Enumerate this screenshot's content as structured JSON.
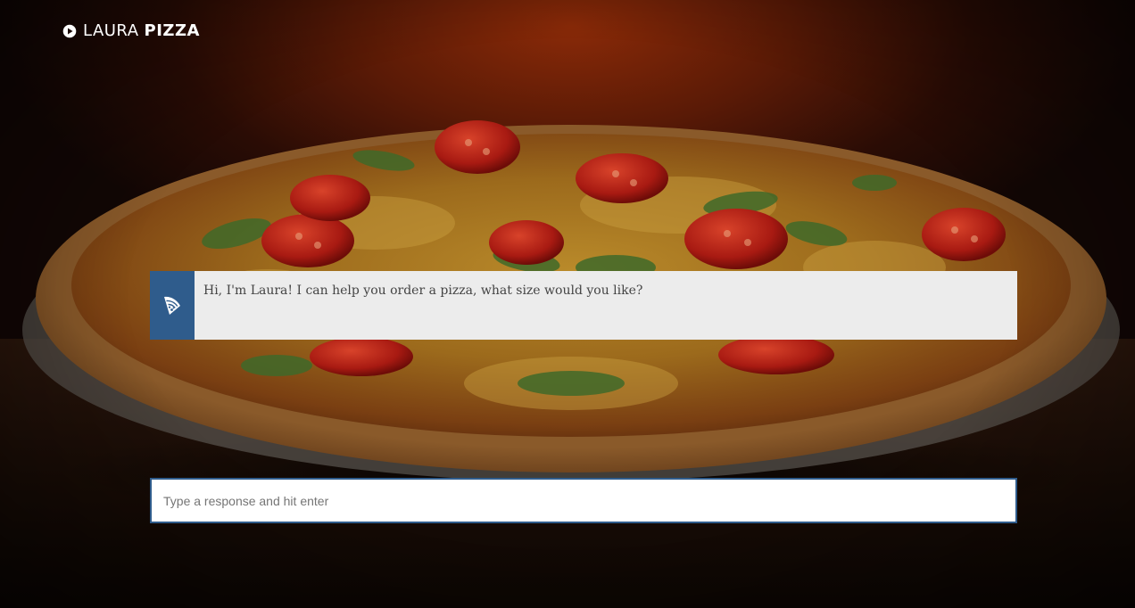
{
  "logo": {
    "first_word": "LAURA",
    "second_word": "PIZZA",
    "icon": "play-circle-icon"
  },
  "chat": {
    "messages": [
      {
        "sender_icon": "pizza-slice-icon",
        "text": "Hi, I'm Laura! I can help you order a pizza, what size would you like?"
      }
    ]
  },
  "input": {
    "placeholder": "Type a response and hit enter",
    "value": ""
  },
  "colors": {
    "accent": "#2f5c8c",
    "message_background": "#ececec",
    "logo_text": "#ffffff"
  }
}
